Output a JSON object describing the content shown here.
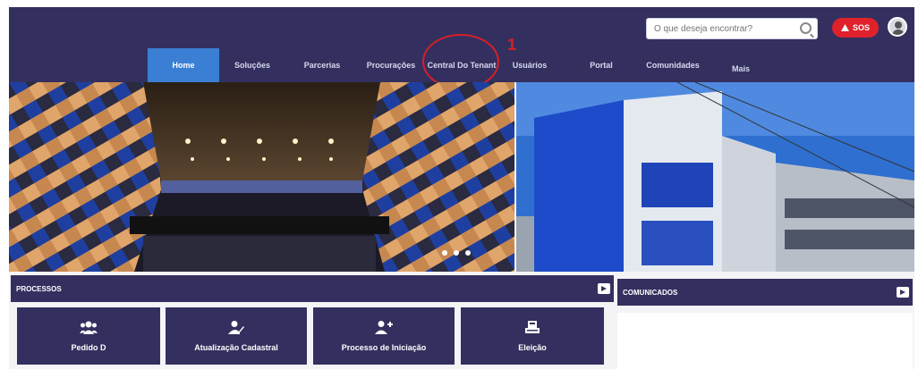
{
  "header": {
    "search_placeholder": "O que deseja encontrar?",
    "alert_label": "SOS",
    "nav": [
      {
        "label": "Home",
        "active": true
      },
      {
        "label": "Soluções",
        "active": false
      },
      {
        "label": "Parcerias",
        "active": false
      },
      {
        "label": "Procurações",
        "active": false
      },
      {
        "label": "Central Do Tenant",
        "active": false
      },
      {
        "label": "Usuários",
        "active": false
      },
      {
        "label": "Portal",
        "active": false
      },
      {
        "label": "Comunidades",
        "active": false
      },
      {
        "label": "Mais",
        "active": false
      }
    ]
  },
  "annotation": {
    "number": "1"
  },
  "processos": {
    "title": "PROCESSOS",
    "cards": [
      {
        "label": "Pedido D",
        "icon": "users-icon"
      },
      {
        "label": "Atualização Cadastral",
        "icon": "user-edit-icon"
      },
      {
        "label": "Processo de Iniciação",
        "icon": "user-plus-icon"
      },
      {
        "label": "Eleição",
        "icon": "ballot-icon"
      }
    ]
  },
  "comunicados": {
    "title": "COMUNICADOS"
  },
  "colors": {
    "brand": "#33305f",
    "active_tab": "#3b7fd4",
    "alert": "#e0212b",
    "annotation": "#d91e28"
  }
}
